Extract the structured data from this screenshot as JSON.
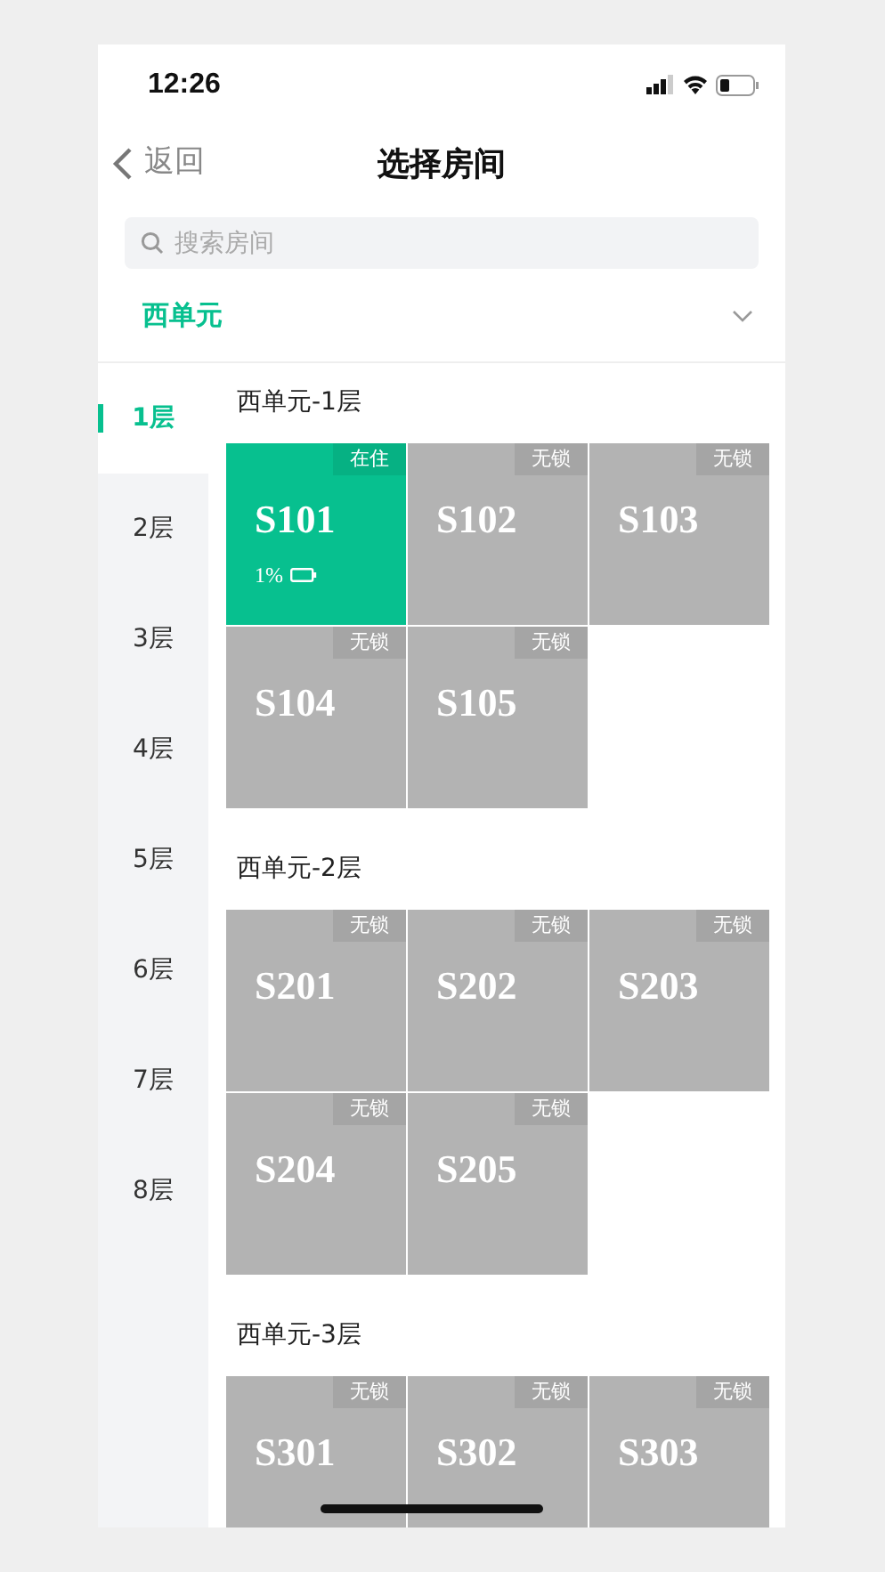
{
  "status_bar": {
    "time": "12:26"
  },
  "nav": {
    "back": "返回",
    "title": "选择房间"
  },
  "search": {
    "placeholder": "搜索房间"
  },
  "unit": {
    "label": "西单元",
    "expanded": false
  },
  "floors": [
    {
      "label": "1层",
      "selected": true
    },
    {
      "label": "2层",
      "selected": false
    },
    {
      "label": "3层",
      "selected": false
    },
    {
      "label": "4层",
      "selected": false
    },
    {
      "label": "5层",
      "selected": false
    },
    {
      "label": "6层",
      "selected": false
    },
    {
      "label": "7层",
      "selected": false
    },
    {
      "label": "8层",
      "selected": false
    }
  ],
  "sections": [
    {
      "title": "西单元-1层",
      "rooms": [
        {
          "name": "S101",
          "tag": "在住",
          "occupied": true,
          "battery": "1%"
        },
        {
          "name": "S102",
          "tag": "无锁",
          "occupied": false
        },
        {
          "name": "S103",
          "tag": "无锁",
          "occupied": false
        },
        {
          "name": "S104",
          "tag": "无锁",
          "occupied": false
        },
        {
          "name": "S105",
          "tag": "无锁",
          "occupied": false
        }
      ]
    },
    {
      "title": "西单元-2层",
      "rooms": [
        {
          "name": "S201",
          "tag": "无锁",
          "occupied": false
        },
        {
          "name": "S202",
          "tag": "无锁",
          "occupied": false
        },
        {
          "name": "S203",
          "tag": "无锁",
          "occupied": false
        },
        {
          "name": "S204",
          "tag": "无锁",
          "occupied": false
        },
        {
          "name": "S205",
          "tag": "无锁",
          "occupied": false
        }
      ]
    },
    {
      "title": "西单元-3层",
      "rooms": [
        {
          "name": "S301",
          "tag": "无锁",
          "occupied": false
        },
        {
          "name": "S302",
          "tag": "无锁",
          "occupied": false
        },
        {
          "name": "S303",
          "tag": "无锁",
          "occupied": false
        }
      ]
    }
  ]
}
